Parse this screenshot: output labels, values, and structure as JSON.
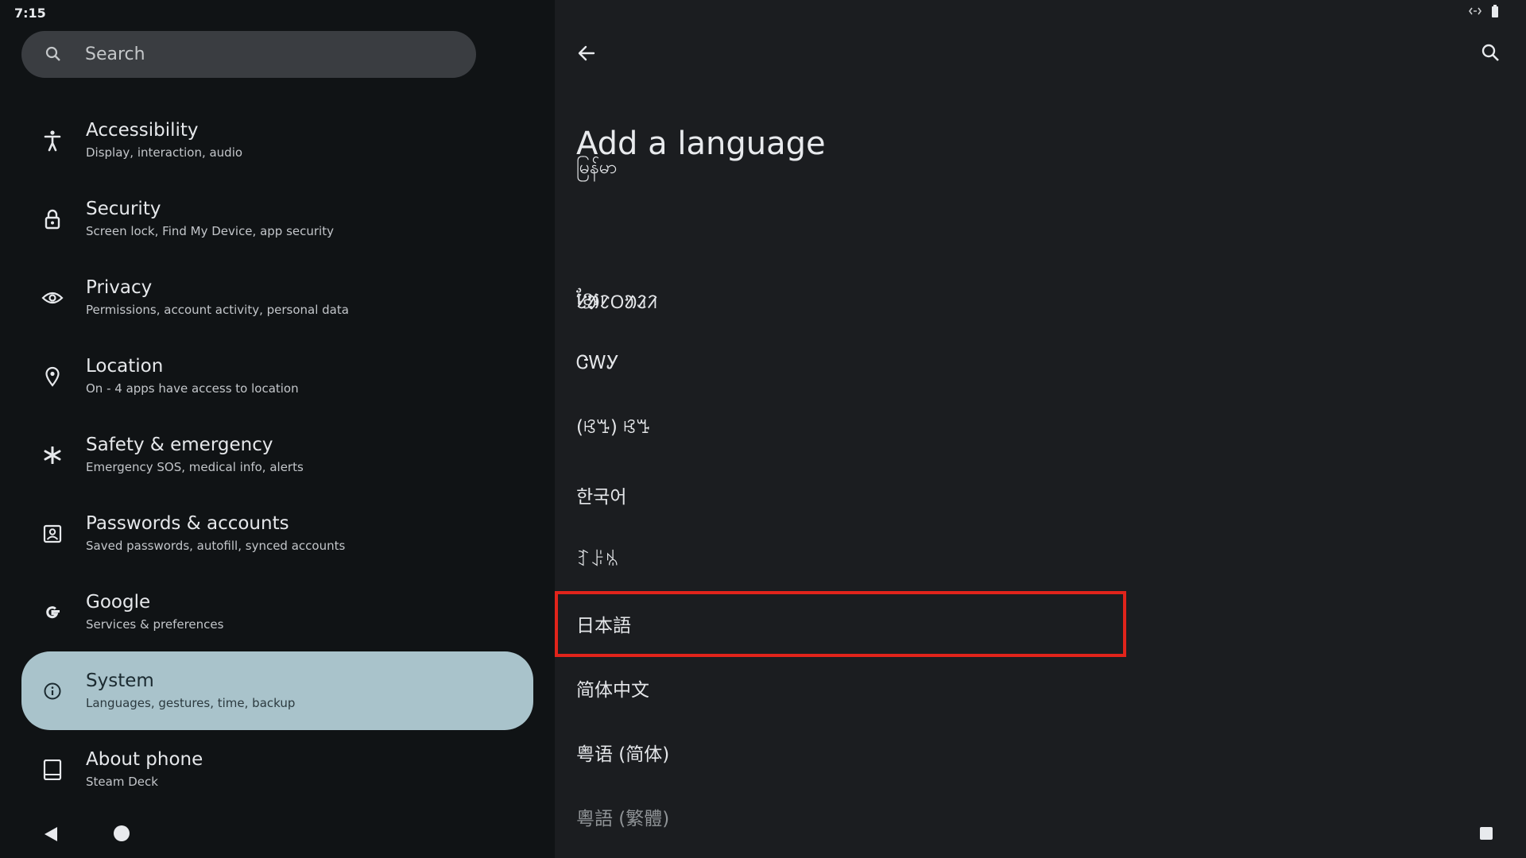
{
  "status_bar": {
    "time": "7:15",
    "icons": [
      "link-icon",
      "battery-icon"
    ]
  },
  "left_pane": {
    "search": {
      "placeholder": "Search",
      "icon": "search-icon"
    },
    "items": [
      {
        "title": "Accessibility",
        "subtitle": "Display, interaction, audio",
        "icon": "accessibility-icon",
        "selected": false
      },
      {
        "title": "Security",
        "subtitle": "Screen lock, Find My Device, app security",
        "icon": "lock-icon",
        "selected": false
      },
      {
        "title": "Privacy",
        "subtitle": "Permissions, account activity, personal data",
        "icon": "eye-icon",
        "selected": false
      },
      {
        "title": "Location",
        "subtitle": "On - 4 apps have access to location",
        "icon": "location-pin-icon",
        "selected": false
      },
      {
        "title": "Safety & emergency",
        "subtitle": "Emergency SOS, medical info, alerts",
        "icon": "asterisk-icon",
        "selected": false
      },
      {
        "title": "Passwords & accounts",
        "subtitle": "Saved passwords, autofill, synced accounts",
        "icon": "account-box-icon",
        "selected": false
      },
      {
        "title": "Google",
        "subtitle": "Services & preferences",
        "icon": "google-icon",
        "selected": false
      },
      {
        "title": "System",
        "subtitle": "Languages, gestures, time, backup",
        "icon": "info-icon",
        "selected": true
      },
      {
        "title": "About phone",
        "subtitle": "Steam Deck",
        "icon": "tablet-icon",
        "selected": false
      }
    ]
  },
  "right_pane": {
    "title": "Add a language",
    "back_icon": "arrow-back-icon",
    "search_icon": "search-icon",
    "languages": [
      "မြန်မာ",
      "ខ្មែរ",
      "ᱥᱟᱱᱛᱟᱲᱤ",
      "ᏣᎳᎩ",
      "(ꕙꔤ) ꕙꔤ",
      "한국어",
      "ꆈꌠꁱ",
      "日本語",
      "简体中文",
      "粤语 (简体)",
      "粵語 (繁體)"
    ],
    "highlighted_language": "日本語"
  },
  "nav_bar": {
    "back": "nav-back-icon",
    "home": "nav-home-icon",
    "recents": "nav-recents-icon"
  },
  "colors": {
    "left_bg": "#101315",
    "right_bg": "#1b1d20",
    "selected_bg": "#a9c3cb",
    "search_bg": "#3a3d41",
    "highlight": "#e1241b"
  }
}
